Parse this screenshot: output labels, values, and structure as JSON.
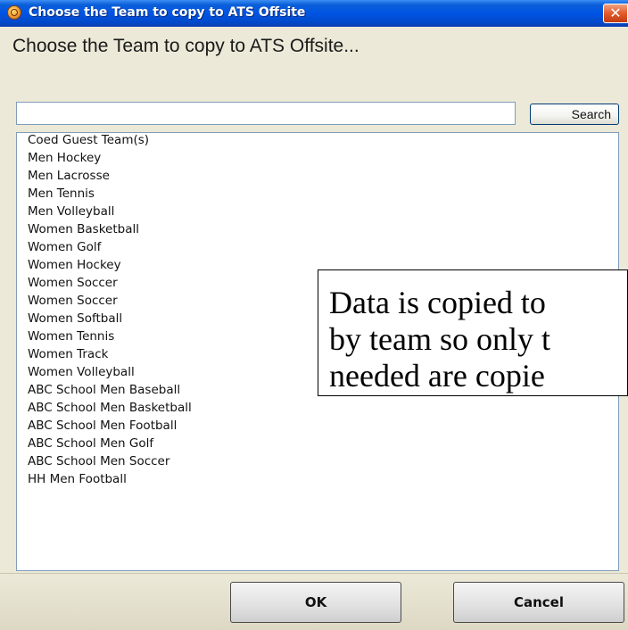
{
  "window": {
    "title": "Choose the Team to copy to ATS Offsite",
    "close_glyph": "✕"
  },
  "heading": "Choose the Team to copy to ATS Offsite...",
  "search": {
    "value": "",
    "button_label": "Search"
  },
  "teams": [
    "Coed Guest Team(s)",
    "Men Hockey",
    "Men Lacrosse",
    "Men Tennis",
    "Men Volleyball",
    "Women Basketball",
    "Women Golf",
    "Women Hockey",
    "Women Soccer",
    "Women Soccer",
    "Women Softball",
    "Women Tennis",
    "Women Track",
    "Women Volleyball",
    "ABC School Men Baseball",
    "ABC School Men Basketball",
    "ABC School Men Football",
    "ABC School Men Golf",
    "ABC School Men Soccer",
    "HH Men Football"
  ],
  "buttons": {
    "ok": "OK",
    "cancel": "Cancel"
  },
  "callout": {
    "lines": [
      "Data is copied to",
      "by team so only t",
      "needed are copie"
    ]
  },
  "icons": {
    "app": "app-icon",
    "close": "close-icon"
  }
}
